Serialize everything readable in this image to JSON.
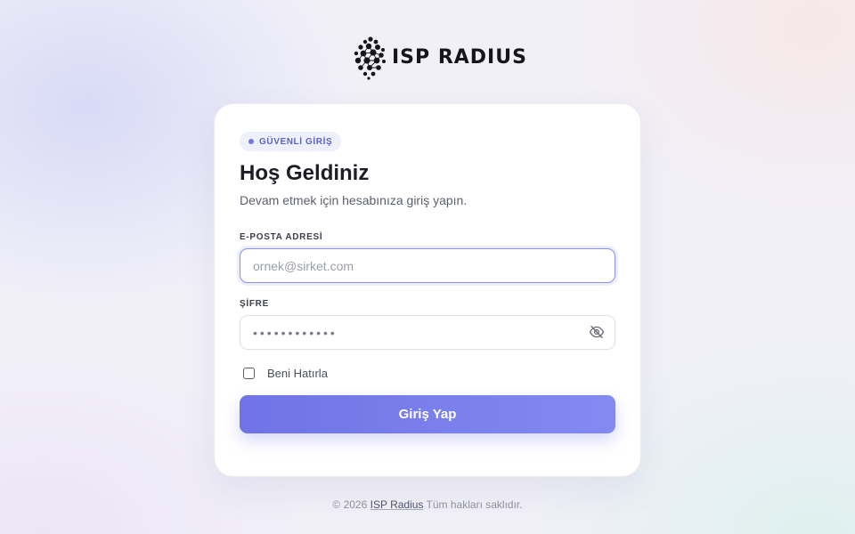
{
  "brand": {
    "name": "ISP RADIUS",
    "logo_icon": "globe-dots-icon"
  },
  "card": {
    "badge": "GÜVENLİ GİRİŞ",
    "title": "Hoş Geldiniz",
    "subtitle": "Devam etmek için hesabınıza giriş yapın."
  },
  "form": {
    "email_label": "E-POSTA ADRESİ",
    "email_value": "",
    "email_placeholder": "ornek@sirket.com",
    "password_label": "ŞİFRE",
    "password_value": "••••••••••••",
    "password_toggle_icon": "eye-off-icon",
    "remember_label": "Beni Hatırla",
    "remember_checked": false,
    "submit_label": "Giriş Yap"
  },
  "footer": {
    "copyright": "© 2026",
    "link": "ISP Radius",
    "rights": "Tüm hakları saklıdır."
  },
  "colors": {
    "accent": "#6f73e6",
    "accent_end": "#838af0",
    "badge_bg": "#eef0fc",
    "text_primary": "#1c1d26"
  }
}
